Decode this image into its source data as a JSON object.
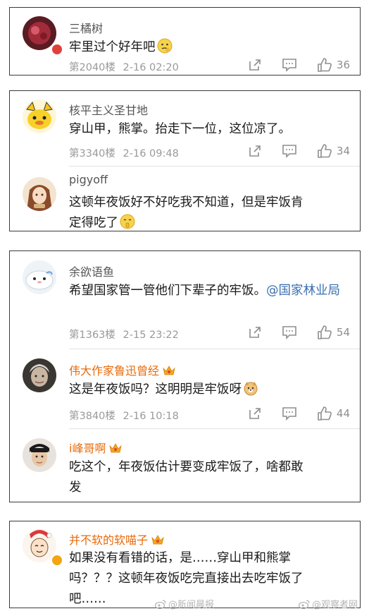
{
  "cards": [
    {
      "comments": [
        {
          "name": "三橘树",
          "text": "牢里过个好年吧",
          "floor": "第2040楼",
          "time": "2-16 02:20",
          "likes": "36"
        }
      ]
    },
    {
      "comments": [
        {
          "name": "核平主义圣甘地",
          "text": "穿山甲，熊掌。抬走下一位，这位凉了。",
          "floor": "第3340楼",
          "time": "2-16 09:48",
          "likes": "34"
        },
        {
          "name": "pigyoff",
          "text_line1": "这顿年夜饭好不好吃我不知道，但是牢饭肯",
          "text_line2": "定得吃了"
        }
      ]
    },
    {
      "comments": [
        {
          "name": "余欲语鱼",
          "text_main": "希望国家管一管他们下辈子的牢饭。",
          "mention": "@国家林业局",
          "floor": "第1363楼",
          "time": "2-15 23:22",
          "likes": "54"
        },
        {
          "name": "伟大作家鲁迅曾经",
          "text": "这是年夜饭吗？这明明是牢饭呀",
          "floor": "第3840楼",
          "time": "2-16 10:18",
          "likes": "44"
        },
        {
          "name": "i峰哥啊",
          "text_line1": "吃这个，年夜饭估计要变成牢饭了，啥都敢",
          "text_line2": "发"
        }
      ]
    },
    {
      "comments": [
        {
          "name": "并不软的软喵子",
          "text_line1": "如果没有看错的话，是……穿山甲和熊掌",
          "text_line2": "吗？？？这顿年夜饭吃完直接出去吃牢饭了",
          "text_line3": "吧……"
        }
      ]
    }
  ],
  "watermarks": [
    "@新闻晨报",
    "@观察者网"
  ],
  "colors": {
    "vip_name": "#e86b0a",
    "mention": "#3a6fb0",
    "meta": "#9a9a9a"
  }
}
